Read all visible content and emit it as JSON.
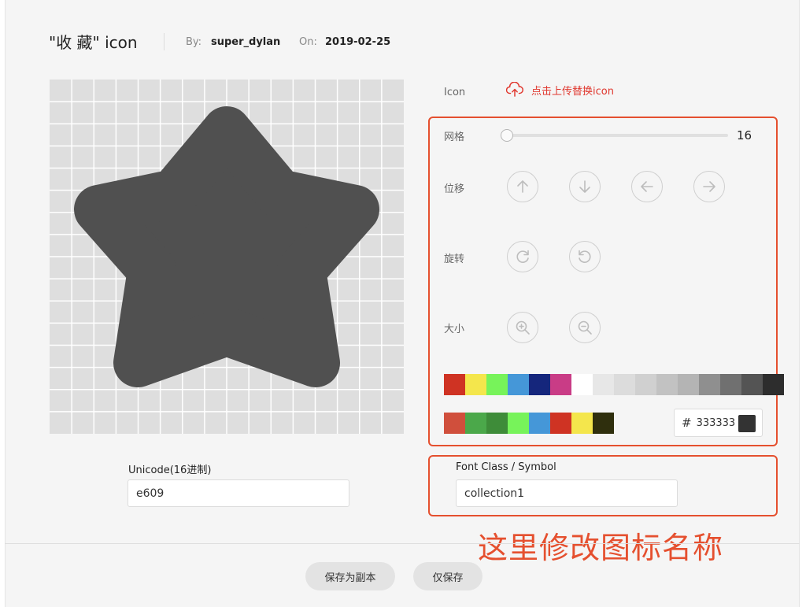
{
  "header": {
    "title": "\"收 藏\" icon",
    "by_label": "By:",
    "by_value": "super_dylan",
    "on_label": "On:",
    "on_value": "2019-02-25"
  },
  "controls": {
    "icon_label": "Icon",
    "upload_text": "点击上传替换icon",
    "grid_label": "网格",
    "grid_value": "16",
    "grid_slider_fraction": 0,
    "move_label": "位移",
    "rotate_label": "旋转",
    "size_label": "大小"
  },
  "palette": {
    "row1": [
      "#cf3323",
      "#f4e64c",
      "#77f35a",
      "#4597d8",
      "#15267c",
      "#c93c86",
      "#ffffff",
      "#e7e7e7",
      "#dcdcdc",
      "#d0d0d0",
      "#c2c2c2",
      "#b4b4b4",
      "#8f8f8f",
      "#707070",
      "#545454",
      "#2d2d2d"
    ],
    "row2": [
      "#d04f3c",
      "#4ba84a",
      "#3e8c39",
      "#77f35a",
      "#4597d8",
      "#cf3323",
      "#f4e64c",
      "#2f2f0d"
    ],
    "hash": "#",
    "hex_value": "333333",
    "preview_color": "#333333"
  },
  "fields": {
    "unicode_label": "Unicode(16进制)",
    "unicode_value": "e609",
    "class_label": "Font Class / Symbol",
    "class_value": "collection1"
  },
  "annotation": "这里修改图标名称",
  "footer": {
    "save_copy": "保存为副本",
    "save_only": "仅保存"
  },
  "colors": {
    "accent": "#e5502f",
    "icon_fill": "#505050",
    "grid_bg": "#dedede"
  }
}
